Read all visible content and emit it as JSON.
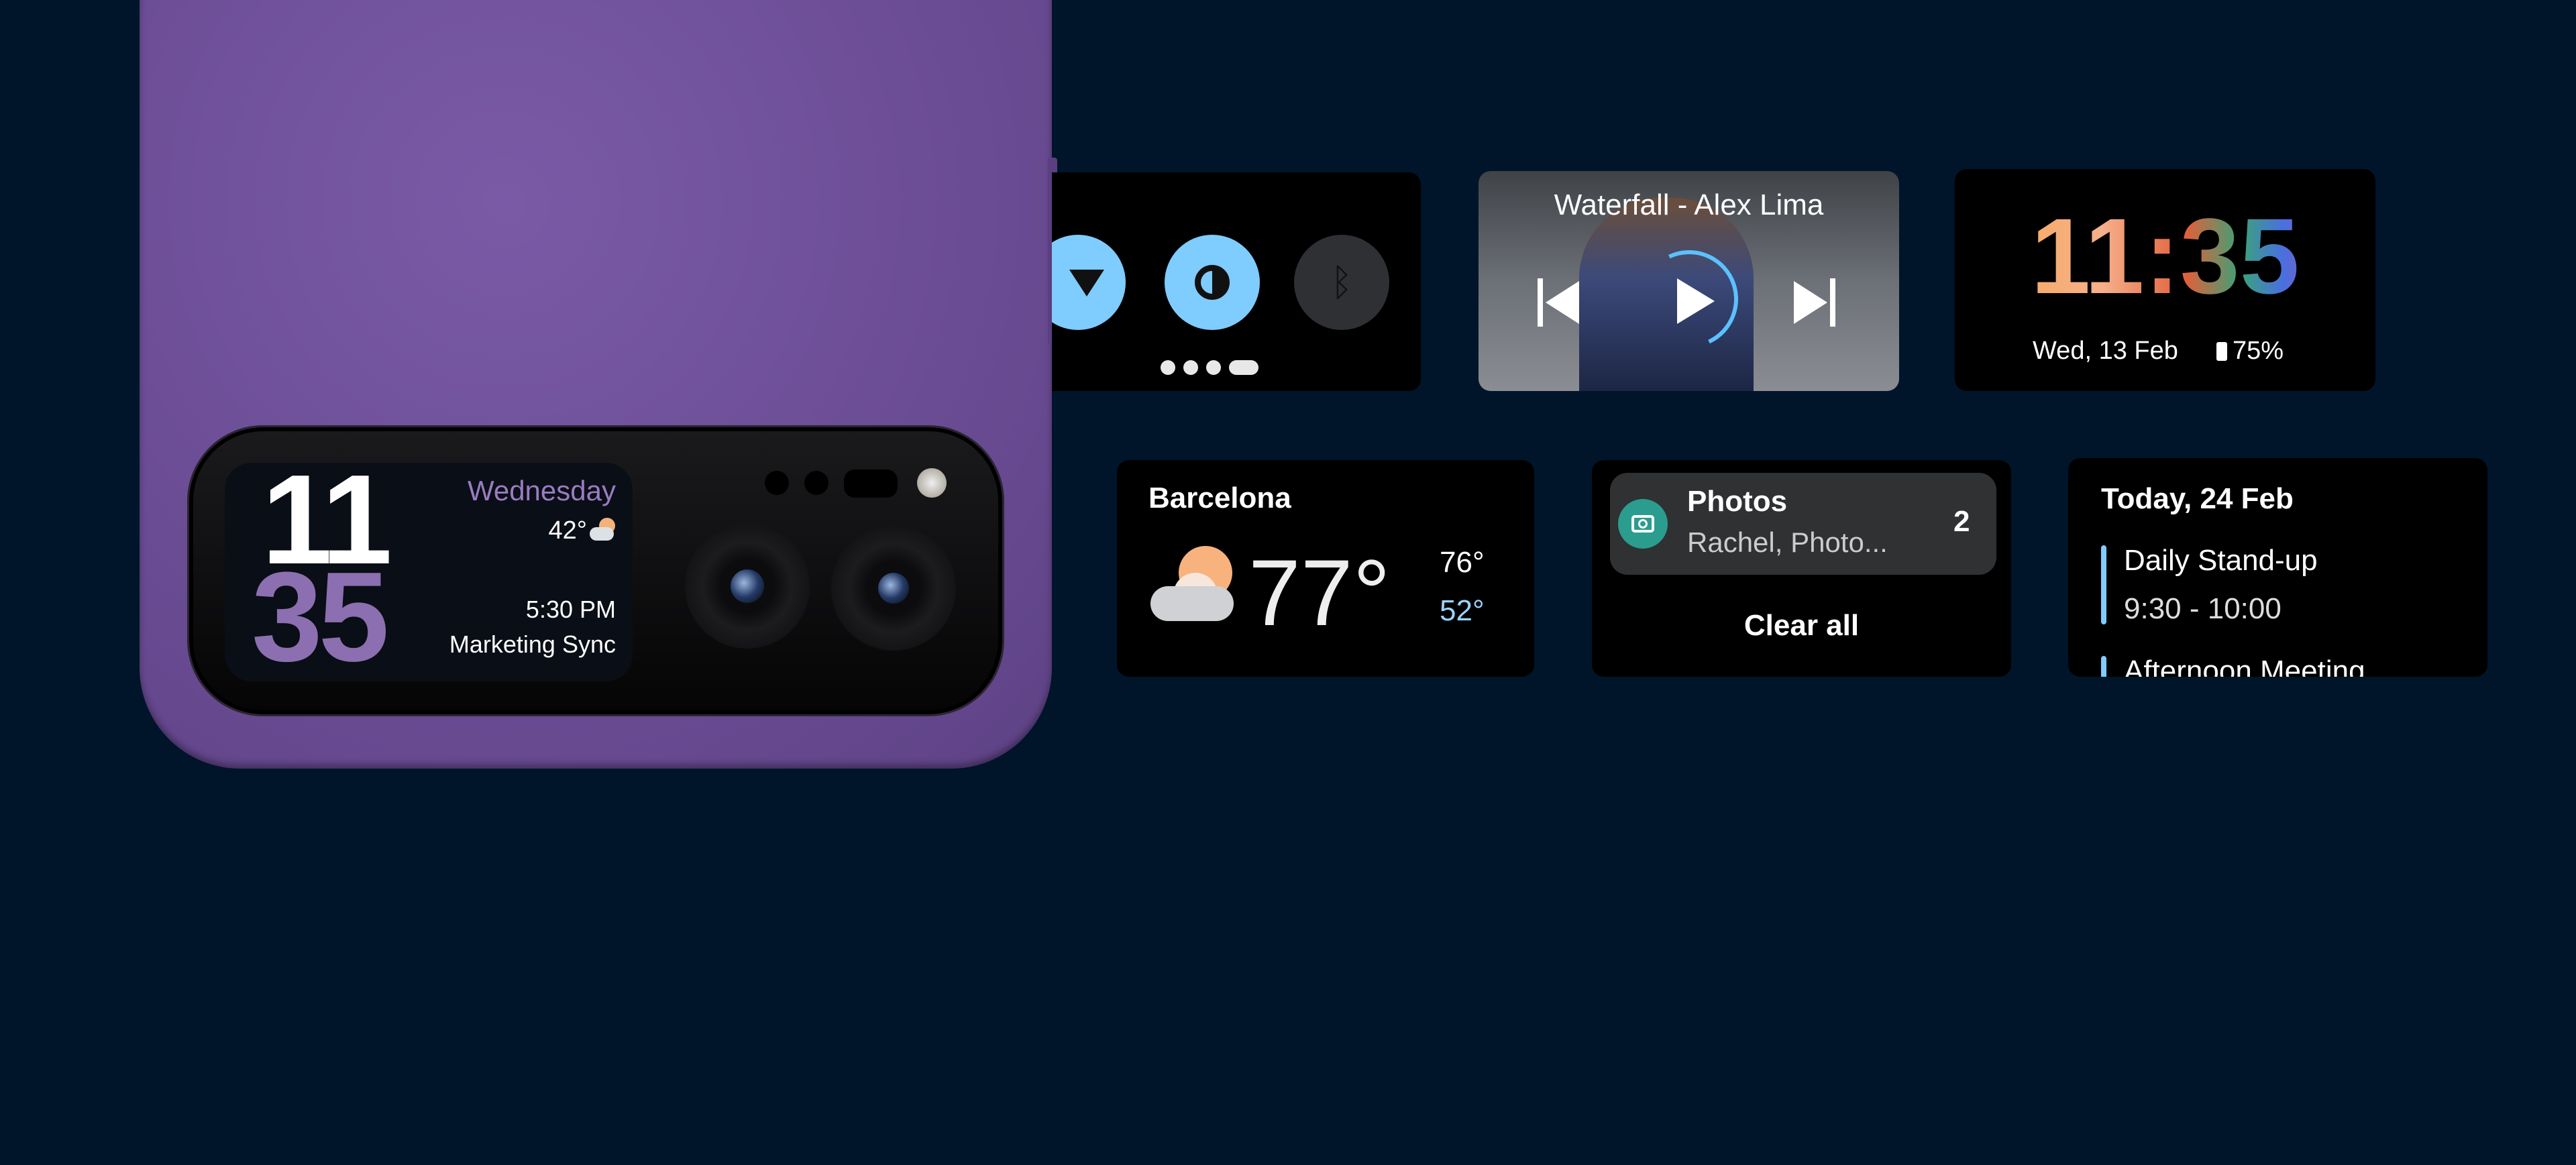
{
  "phone_cover_screen": {
    "hour": "11",
    "minute": "35",
    "day": "Wednesday",
    "temperature": "42°",
    "event_time": "5:30 PM",
    "event_title": "Marketing Sync",
    "colors": {
      "minute": "#8c6fb0",
      "day": "#9a7cc0",
      "body": "#6e4f99"
    }
  },
  "quick_settings": {
    "tiles": [
      {
        "icon": "wifi-icon",
        "active": true
      },
      {
        "icon": "brightness-icon",
        "active": true
      },
      {
        "icon": "bluetooth-icon",
        "active": false
      }
    ],
    "page_count": 4,
    "current_page": 4,
    "accent": "#7fccff"
  },
  "media": {
    "title": "Waterfall - Alex Lima",
    "progress": 0.45,
    "controls": [
      "previous-icon",
      "play-icon",
      "next-icon"
    ]
  },
  "clock_widget": {
    "time": "11:35",
    "date": "Wed, 13 Feb",
    "battery": "75%"
  },
  "weather": {
    "city": "Barcelona",
    "current": "77°",
    "high": "76°",
    "low": "52°",
    "icon": "partly-cloudy-icon"
  },
  "notifications": {
    "app": "Photos",
    "preview": "Rachel, Photo...",
    "count": "2",
    "clear_label": "Clear all",
    "icon_color": "#2a9d8f"
  },
  "calendar": {
    "date": "Today, 24 Feb",
    "events": [
      {
        "title": "Daily Stand-up",
        "time": "9:30 - 10:00"
      },
      {
        "title": "Afternoon Meeting"
      }
    ],
    "accent": "#7fccff"
  }
}
